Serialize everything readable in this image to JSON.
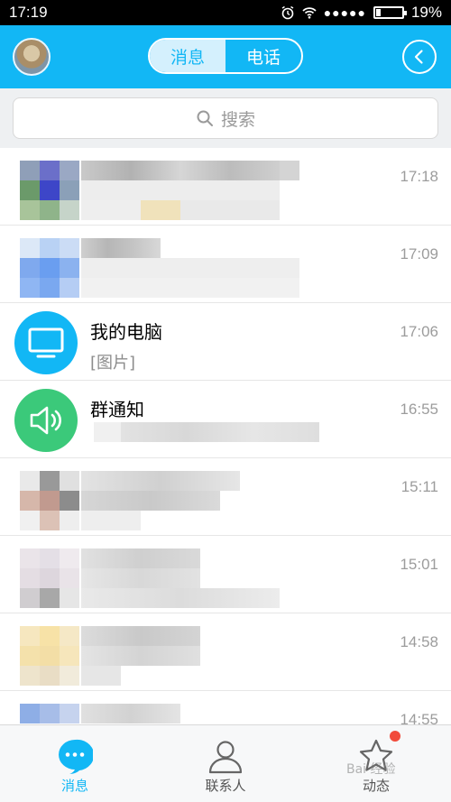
{
  "status_bar": {
    "time": "17:19",
    "battery": "19%",
    "battery_level": 0.19
  },
  "header": {
    "tabs": [
      {
        "label": "消息",
        "active": true
      },
      {
        "label": "电话",
        "active": false
      }
    ],
    "accent_color": "#12b7f5"
  },
  "search": {
    "placeholder": "搜索"
  },
  "conversations": [
    {
      "name": "",
      "preview": "",
      "time": "17:18",
      "blurred": true
    },
    {
      "name": "",
      "preview": "",
      "time": "17:09",
      "blurred": true
    },
    {
      "name": "我的电脑",
      "preview": "[图片]",
      "time": "17:06",
      "icon": "monitor-icon",
      "icon_color": "#12b7f5"
    },
    {
      "name": "群通知",
      "preview": "",
      "time": "16:55",
      "icon": "speaker-icon",
      "icon_color": "#3bc97a",
      "blurred_preview": true
    },
    {
      "name": "",
      "preview": "",
      "time": "15:11",
      "blurred": true
    },
    {
      "name": "",
      "preview": "",
      "time": "15:01",
      "blurred": true
    },
    {
      "name": "",
      "preview": "",
      "time": "14:58",
      "blurred": true
    },
    {
      "name": "",
      "preview": "",
      "time": "14:55",
      "blurred": true
    }
  ],
  "tab_bar": {
    "items": [
      {
        "label": "消息",
        "icon": "chat-bubble-icon",
        "active": true
      },
      {
        "label": "联系人",
        "icon": "person-icon",
        "active": false
      },
      {
        "label": "动态",
        "icon": "star-icon",
        "active": false,
        "has_badge": true
      }
    ]
  },
  "watermark": "Bai 经验"
}
